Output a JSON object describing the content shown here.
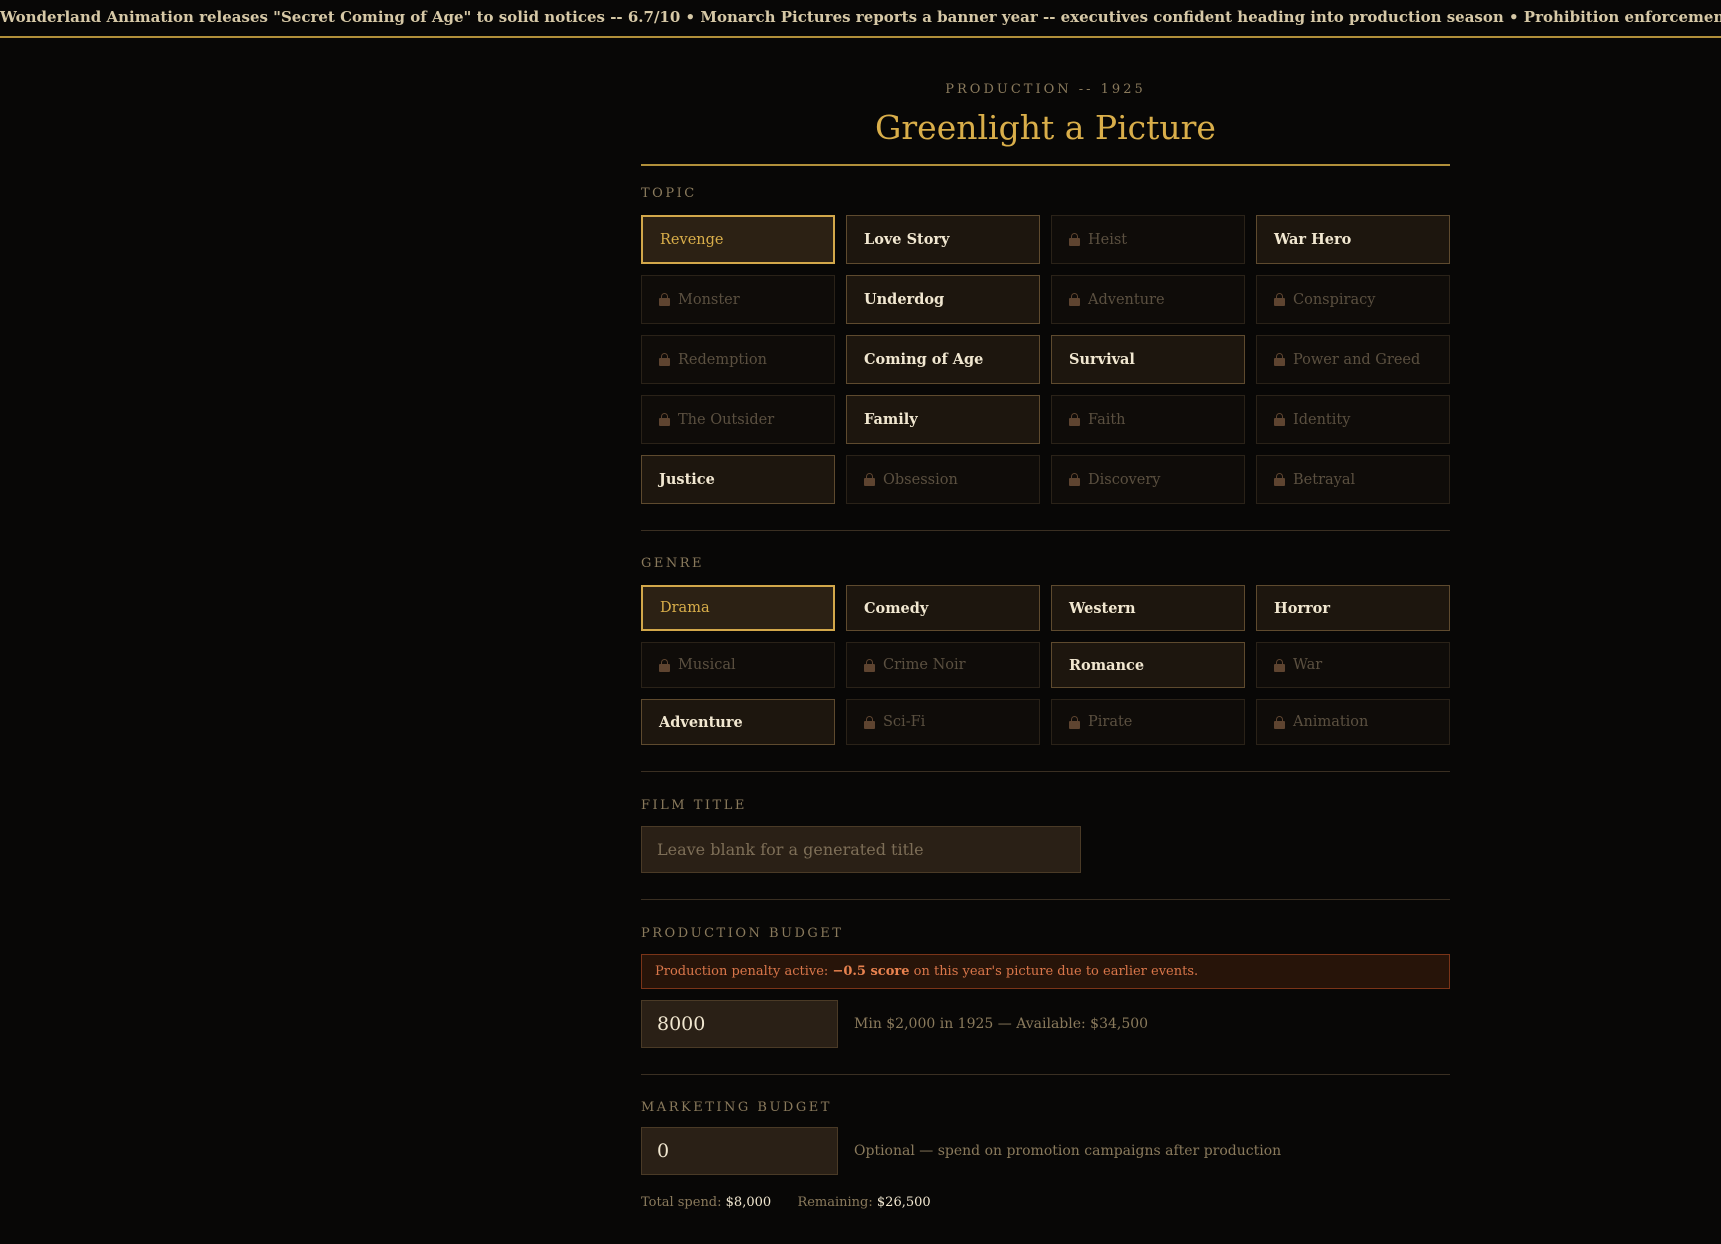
{
  "ticker": {
    "text": "Wonderland Animation releases \"Secret Coming of Age\" to solid notices -- 6.7/10 • Monarch Pictures reports a banner year -- executives confident heading into production season • Prohibition enforcement sweeps Los Angeles -- speakeasies re"
  },
  "header": {
    "eyebrow": "PRODUCTION -- 1925",
    "title": "Greenlight a Picture"
  },
  "topic": {
    "label": "TOPIC",
    "options": [
      {
        "label": "Revenge",
        "state": "selected"
      },
      {
        "label": "Love Story",
        "state": "available"
      },
      {
        "label": "Heist",
        "state": "locked"
      },
      {
        "label": "War Hero",
        "state": "available"
      },
      {
        "label": "Monster",
        "state": "locked"
      },
      {
        "label": "Underdog",
        "state": "available"
      },
      {
        "label": "Adventure",
        "state": "locked"
      },
      {
        "label": "Conspiracy",
        "state": "locked"
      },
      {
        "label": "Redemption",
        "state": "locked"
      },
      {
        "label": "Coming of Age",
        "state": "available"
      },
      {
        "label": "Survival",
        "state": "available"
      },
      {
        "label": "Power and Greed",
        "state": "locked"
      },
      {
        "label": "The Outsider",
        "state": "locked"
      },
      {
        "label": "Family",
        "state": "available"
      },
      {
        "label": "Faith",
        "state": "locked"
      },
      {
        "label": "Identity",
        "state": "locked"
      },
      {
        "label": "Justice",
        "state": "available"
      },
      {
        "label": "Obsession",
        "state": "locked"
      },
      {
        "label": "Discovery",
        "state": "locked"
      },
      {
        "label": "Betrayal",
        "state": "locked"
      }
    ]
  },
  "genre": {
    "label": "GENRE",
    "options": [
      {
        "label": "Drama",
        "state": "selected"
      },
      {
        "label": "Comedy",
        "state": "available"
      },
      {
        "label": "Western",
        "state": "available"
      },
      {
        "label": "Horror",
        "state": "available"
      },
      {
        "label": "Musical",
        "state": "locked"
      },
      {
        "label": "Crime Noir",
        "state": "locked"
      },
      {
        "label": "Romance",
        "state": "available"
      },
      {
        "label": "War",
        "state": "locked"
      },
      {
        "label": "Adventure",
        "state": "available"
      },
      {
        "label": "Sci-Fi",
        "state": "locked"
      },
      {
        "label": "Pirate",
        "state": "locked"
      },
      {
        "label": "Animation",
        "state": "locked"
      }
    ]
  },
  "film_title": {
    "label": "FILM TITLE",
    "value": "",
    "placeholder": "Leave blank for a generated title"
  },
  "production_budget": {
    "label": "PRODUCTION BUDGET",
    "penalty_prefix": "Production penalty active: ",
    "penalty_strong": "−0.5 score",
    "penalty_suffix": " on this year's picture due to earlier events.",
    "value": "8000",
    "hint": "Min $2,000 in 1925 — Available: $34,500"
  },
  "marketing_budget": {
    "label": "MARKETING BUDGET",
    "value": "0",
    "hint": "Optional — spend on promotion campaigns after production"
  },
  "totals": {
    "spend_label": "Total spend:",
    "spend_value": "$8,000",
    "remaining_label": "Remaining:",
    "remaining_value": "$26,500"
  },
  "colors": {
    "accent": "#d9ae4a",
    "background": "#080706",
    "penalty": "#d9764a"
  },
  "icons": {
    "locked": "lock-icon"
  }
}
